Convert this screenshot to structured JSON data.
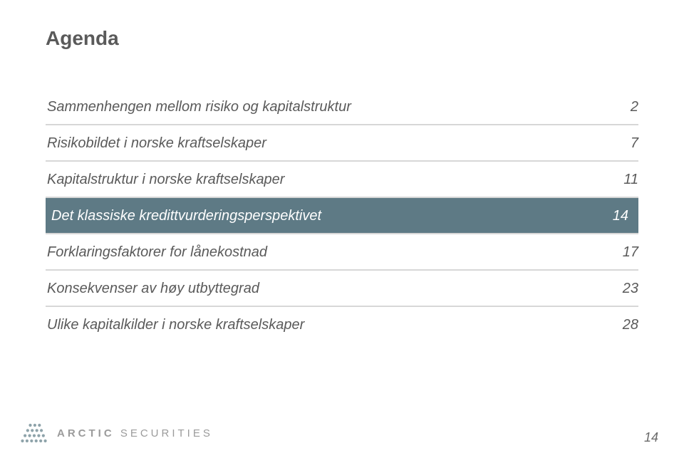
{
  "title": "Agenda",
  "items": [
    {
      "label": "Sammenhengen mellom risiko og kapitalstruktur",
      "page": "2",
      "highlight": false
    },
    {
      "label": "Risikobildet i norske kraftselskaper",
      "page": "7",
      "highlight": false
    },
    {
      "label": "Kapitalstruktur i norske kraftselskaper",
      "page": "11",
      "highlight": false
    },
    {
      "label": "Det klassiske kredittvurderingsperspektivet",
      "page": "14",
      "highlight": true
    },
    {
      "label": "Forklaringsfaktorer for lånekostnad",
      "page": "17",
      "highlight": false
    },
    {
      "label": "Konsekvenser av høy utbyttegrad",
      "page": "23",
      "highlight": false
    },
    {
      "label": "Ulike kapitalkilder i norske kraftselskaper",
      "page": "28",
      "highlight": false
    }
  ],
  "brand": {
    "strong": "ARCTIC",
    "rest": " SECURITIES"
  },
  "page_number": "14"
}
